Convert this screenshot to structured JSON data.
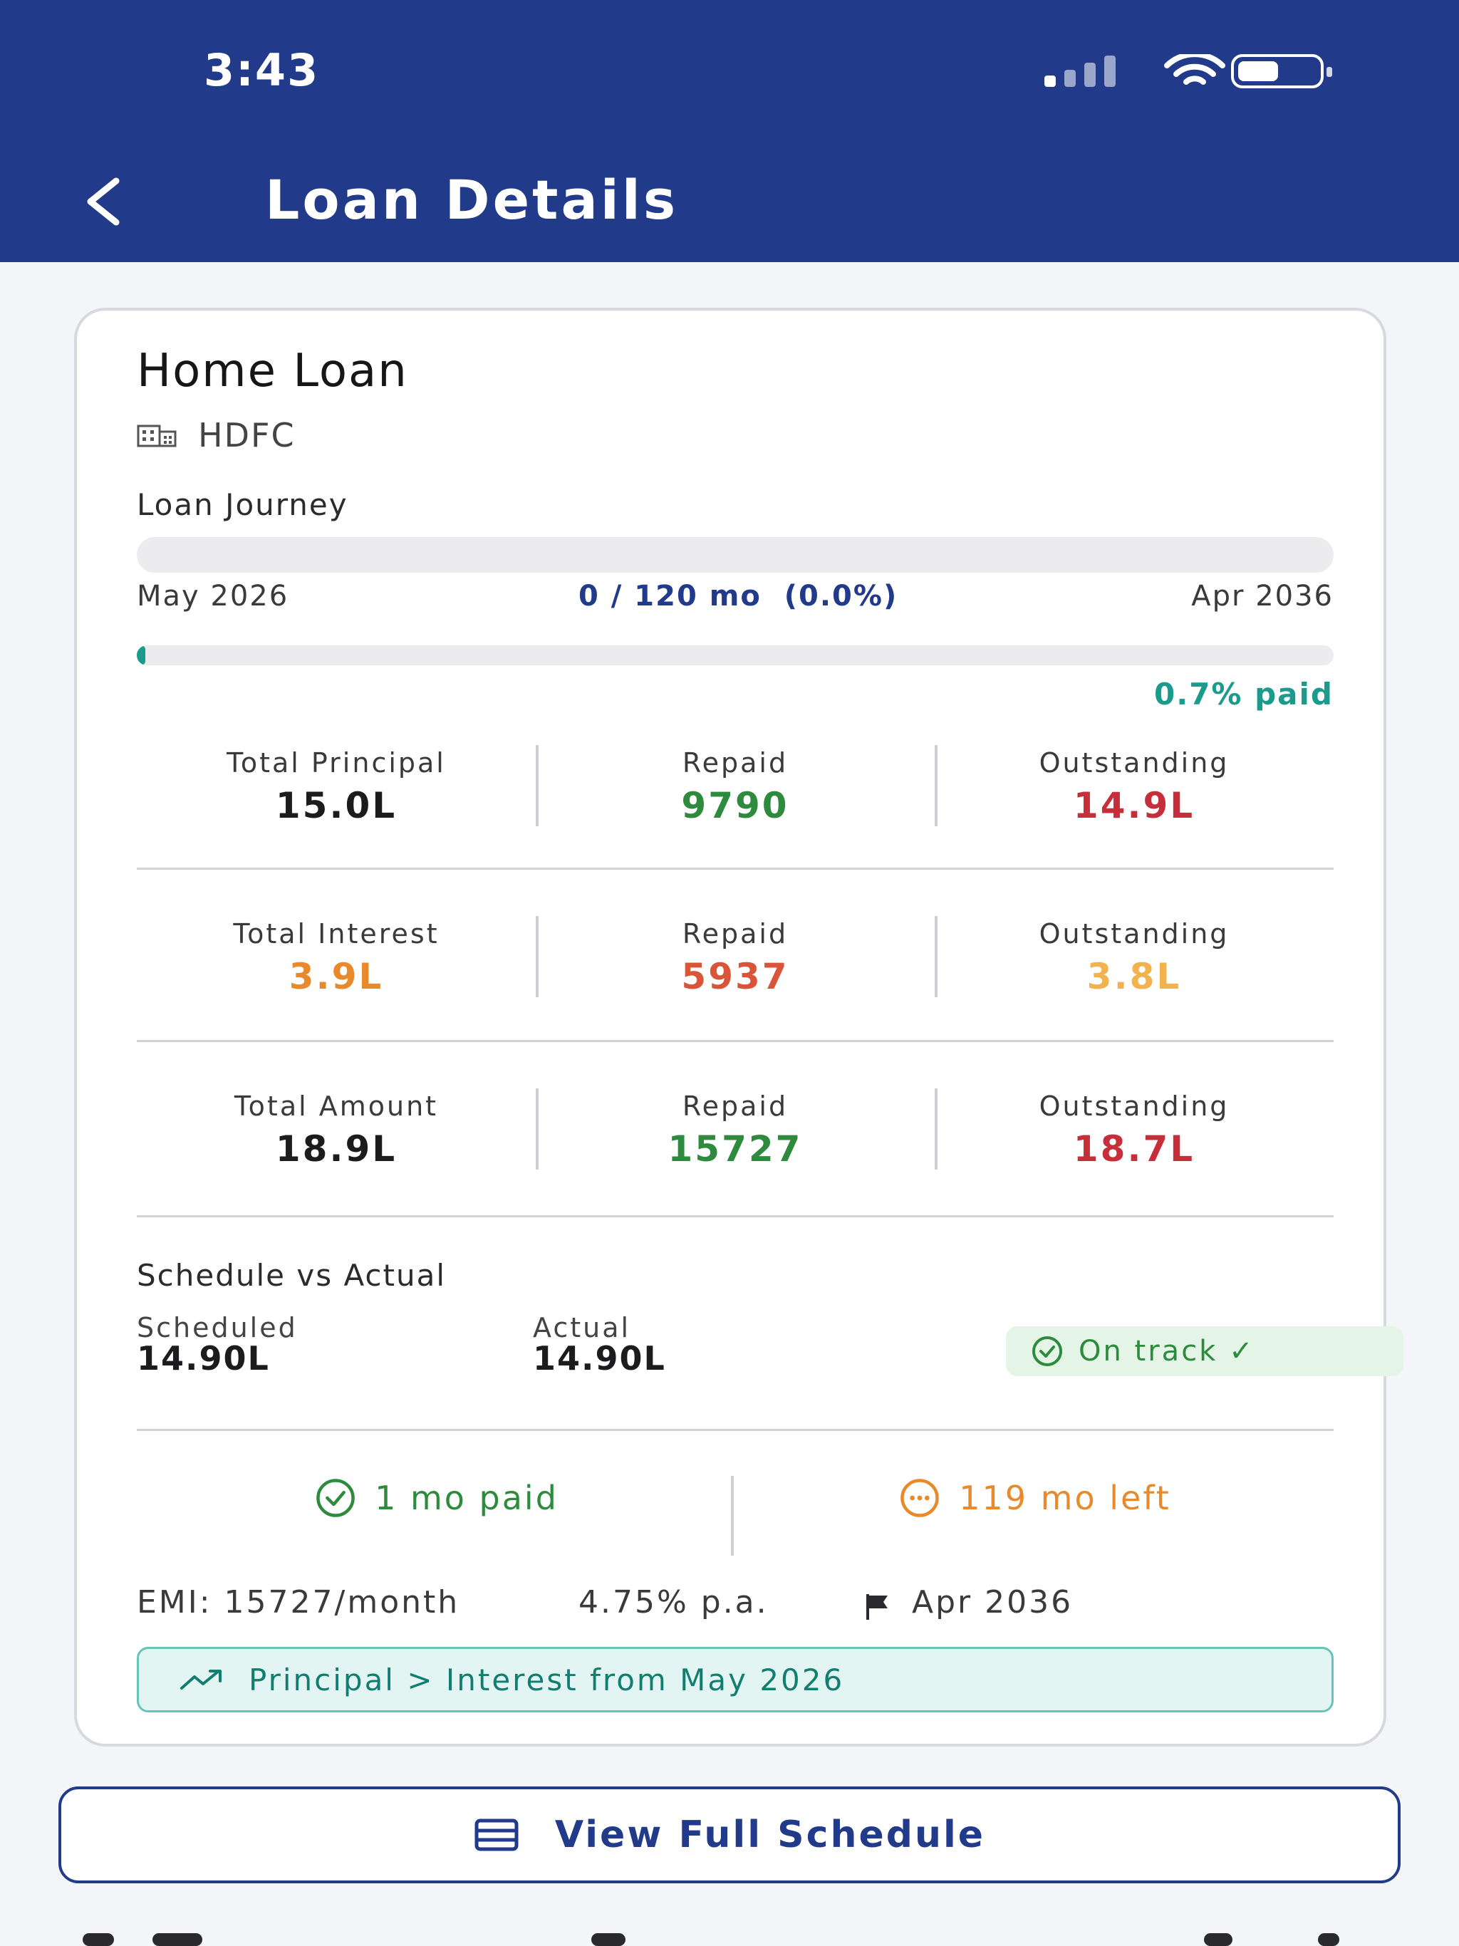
{
  "status_bar": {
    "time": "3:43"
  },
  "header": {
    "title": "Loan Details"
  },
  "loan": {
    "name": "Home Loan",
    "bank": "HDFC"
  },
  "journey": {
    "label": "Loan Journey",
    "start": "May 2026",
    "months_text": "0 / 120 mo",
    "percent_text": "(0.0%)",
    "end": "Apr 2036",
    "paid_fraction": 0.007,
    "paid_text": "0.7% paid"
  },
  "stats": [
    {
      "total_label": "Total Principal",
      "total_value": "15.0L",
      "repaid_label": "Repaid",
      "repaid_value": "9790",
      "outstanding_label": "Outstanding",
      "outstanding_value": "14.9L"
    },
    {
      "total_label": "Total Interest",
      "total_value": "3.9L",
      "repaid_label": "Repaid",
      "repaid_value": "5937",
      "outstanding_label": "Outstanding",
      "outstanding_value": "3.8L"
    },
    {
      "total_label": "Total Amount",
      "total_value": "18.9L",
      "repaid_label": "Repaid",
      "repaid_value": "15727",
      "outstanding_label": "Outstanding",
      "outstanding_value": "18.7L"
    }
  ],
  "schedule": {
    "label": "Schedule vs Actual",
    "scheduled_label": "Scheduled",
    "scheduled_value": "14.90L",
    "actual_label": "Actual",
    "actual_value": "14.90L",
    "status": "On track ✓"
  },
  "progress": {
    "paid": "1 mo paid",
    "left": "119 mo left"
  },
  "terms": {
    "emi": "EMI: 15727/month",
    "rate": "4.75% p.a.",
    "end": "Apr 2036"
  },
  "crossover": "Principal > Interest from May 2026",
  "actions": {
    "view_schedule": "View Full Schedule"
  },
  "colors": {
    "header_bg": "#213a8a",
    "teal": "#1a9b8c",
    "green": "#2e8b3e",
    "red": "#c62f3a",
    "orange": "#e8892c",
    "amber": "#f2b24e"
  }
}
